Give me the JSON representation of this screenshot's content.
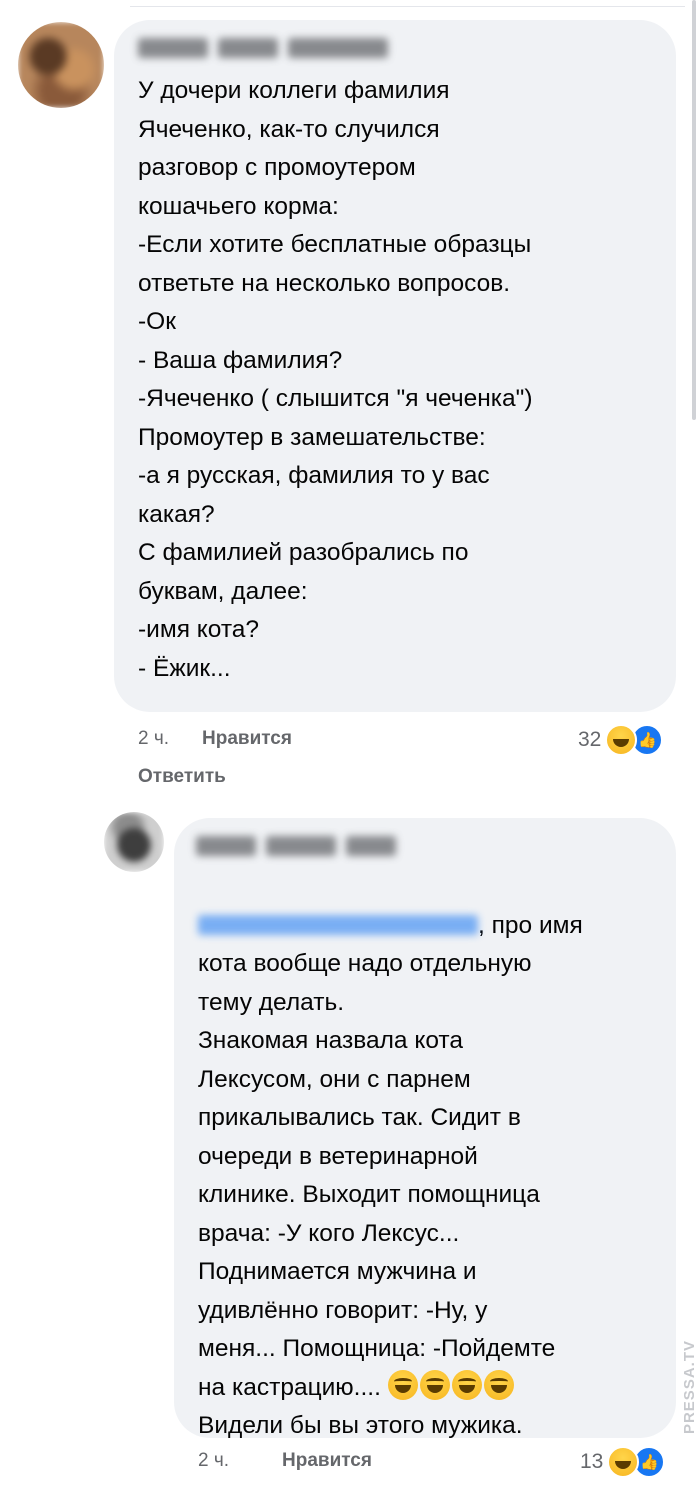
{
  "comment1": {
    "author": "",
    "text": "У дочери коллеги фамилия\nЯчеченко, как-то случился\nразговор с промоутером\nкошачьего корма:\n-Если хотите бесплатные образцы\nответьте на несколько вопросов.\n-Ок\n- Ваша фамилия?\n-Ячеченко ( слышится \"я чеченка\")\nПромоутер в замешательстве:\n-а я русская, фамилия то у вас\nкакая?\nС фамилией разобрались по\nбуквам, далее:\n-имя кота?\n- Ёжик...",
    "time": "2 ч.",
    "like_label": "Нравится",
    "reply_label": "Ответить",
    "reaction_count": "32",
    "reaction_icons": [
      "haha-icon",
      "like-icon"
    ]
  },
  "comment2": {
    "author": "",
    "mention": "",
    "text_after_mention": ", про имя",
    "text": "кота вообще надо отдельную\nтему делать.\nЗнакомая назвала кота\nЛексусом, они с парнем\nприкалывались так. Сидит в\nочереди в ветеринарной\nклинике. Выходит помощница\nврача: -У кого Лексус...\nПоднимается мужчина и\nудивлённо говорит: -Ну, у\nменя... Помощница: -Пойдемте\nна кастрацию....",
    "emoji_count": 4,
    "text_end": "Видели бы вы этого мужика.",
    "time": "2 ч.",
    "like_label": "Нравится",
    "reaction_count": "13",
    "reaction_icons": [
      "haha-icon",
      "like-icon"
    ]
  },
  "watermark": "PRESSA.TV",
  "colors": {
    "bubble": "#f0f2f5",
    "meta": "#65676b",
    "link": "#1877f2"
  }
}
